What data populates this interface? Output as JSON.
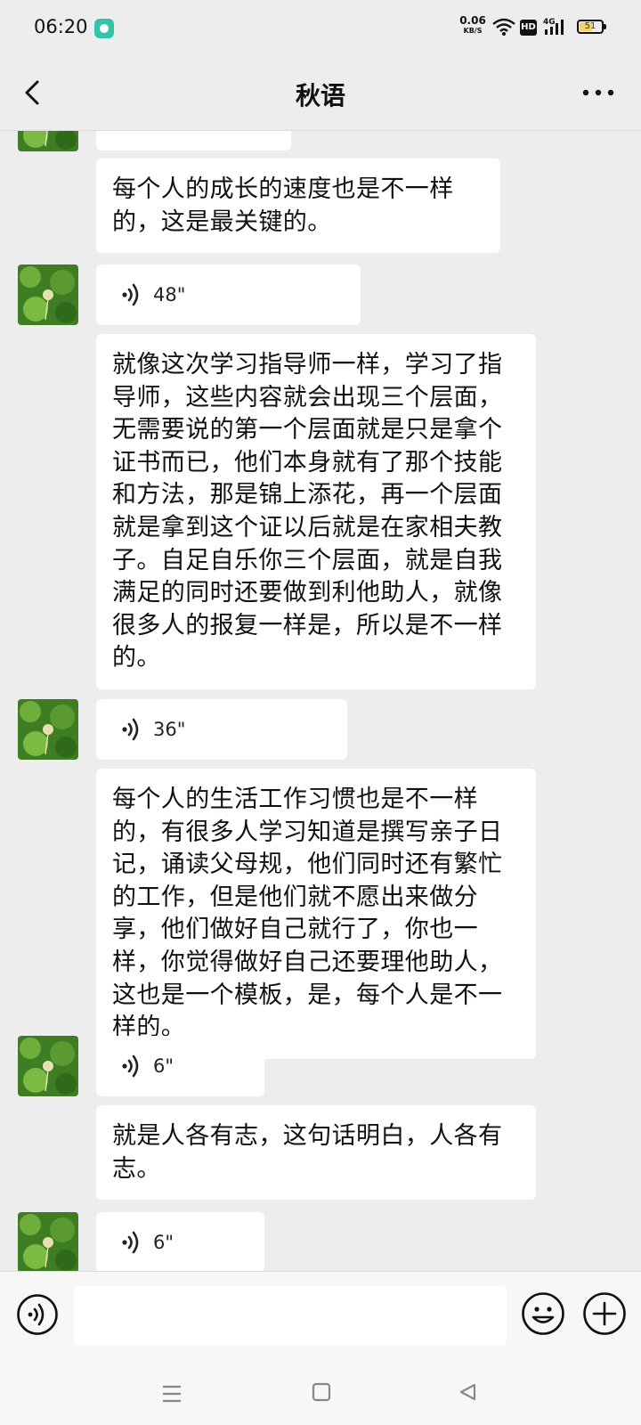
{
  "status_bar": {
    "time": "06:20",
    "net_speed": "0.06",
    "net_speed_unit": "KB/S",
    "hd_label": "HD",
    "network_label": "4G",
    "battery": "51"
  },
  "header": {
    "title": "秋语"
  },
  "messages": [
    {
      "type": "voice",
      "duration": ""
    },
    {
      "type": "text",
      "text": "每个人的成长的速度也是不一样的，这是最关键的。"
    },
    {
      "type": "voice",
      "duration": "48\""
    },
    {
      "type": "text",
      "text": "就像这次学习指导师一样，学习了指导师，这些内容就会出现三个层面，无需要说的第一个层面就是只是拿个证书而已，他们本身就有了那个技能和方法，那是锦上添花，再一个层面就是拿到这个证以后就是在家相夫教子。自足自乐你三个层面，就是自我满足的同时还要做到利他助人，就像很多人的报复一样是，所以是不一样的。"
    },
    {
      "type": "voice",
      "duration": "36\""
    },
    {
      "type": "text",
      "text": "每个人的生活工作习惯也是不一样的，有很多人学习知道是撰写亲子日记，诵读父母规，他们同时还有繁忙的工作，但是他们就不愿出来做分享，他们做好自己就行了，你也一样，你觉得做好自己还要理他助人，这也是一个模板，是，每个人是不一样的。"
    },
    {
      "type": "voice",
      "duration": "6\""
    },
    {
      "type": "text",
      "text": "就是人各有志，这句话明白，人各有志。"
    },
    {
      "type": "voice",
      "duration": "6\""
    }
  ],
  "input": {
    "placeholder": ""
  },
  "icons": {
    "back": "chevron-left-icon",
    "more": "more-dots-icon",
    "voice": "voice-icon",
    "emoji": "emoji-icon",
    "plus": "plus-icon"
  },
  "colors": {
    "background": "#ededed",
    "bubble": "#ffffff",
    "avatar_green": "#4a8a2a"
  }
}
